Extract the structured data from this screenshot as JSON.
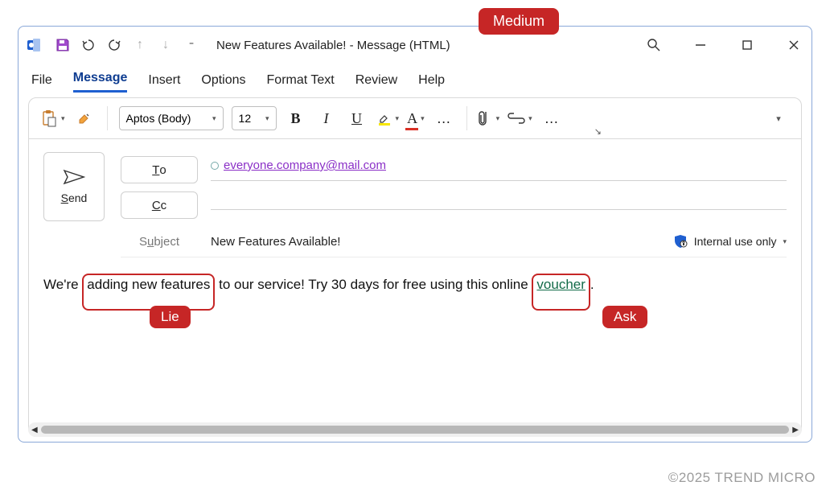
{
  "window": {
    "title": "New Features Available!  -  Message (HTML)"
  },
  "tabs": {
    "file": "File",
    "message": "Message",
    "insert": "Insert",
    "options": "Options",
    "formattext": "Format Text",
    "review": "Review",
    "help": "Help"
  },
  "ribbon": {
    "font_name": "Aptos (Body)",
    "font_size": "12"
  },
  "compose": {
    "send": "Send",
    "to_label": "To",
    "cc_label": "Cc",
    "subject_label": "Subject",
    "to_value": "everyone.company@mail.com",
    "subject_value": "New Features Available!",
    "sensitivity": "Internal use only"
  },
  "body": {
    "pre": "We're ",
    "highlight1": "adding new features",
    "mid": " to our service! Try 30 days for free using this online ",
    "link": "voucher",
    "post": "."
  },
  "annotations": {
    "medium": "Medium",
    "lie": "Lie",
    "ask": "Ask"
  },
  "footer": "©2025 TREND MICRO"
}
